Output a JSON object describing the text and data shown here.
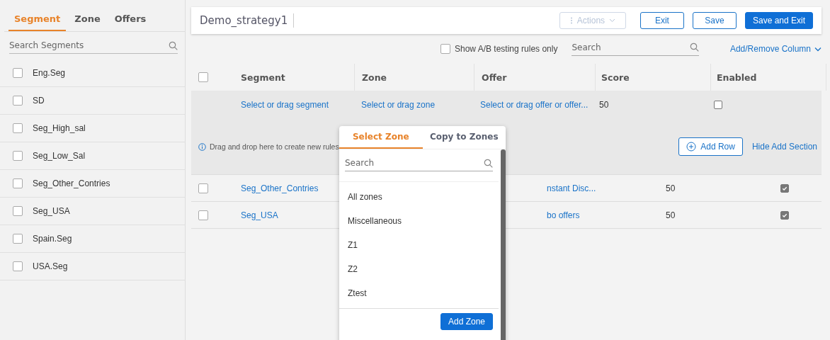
{
  "sidebar": {
    "tabs": [
      {
        "label": "Segment",
        "selected": true
      },
      {
        "label": "Zone",
        "selected": false
      },
      {
        "label": "Offers",
        "selected": false
      }
    ],
    "search": {
      "placeholder": "Search Segments"
    },
    "items": [
      {
        "label": "Eng.Seg",
        "checked": false
      },
      {
        "label": "SD",
        "checked": false
      },
      {
        "label": "Seg_High_sal",
        "checked": false
      },
      {
        "label": "Seg_Low_Sal",
        "checked": false
      },
      {
        "label": "Seg_Other_Contries",
        "checked": false
      },
      {
        "label": "Seg_USA",
        "checked": false
      },
      {
        "label": "Spain.Seg",
        "checked": false
      },
      {
        "label": "USA.Seg",
        "checked": false
      }
    ]
  },
  "header": {
    "title": "Demo_strategy1",
    "actions": {
      "label": "Actions",
      "disabled": true
    },
    "buttons": [
      {
        "label": "Exit",
        "kind": "outline"
      },
      {
        "label": "Save",
        "kind": "outline"
      },
      {
        "label": "Save and Exit",
        "kind": "primary"
      }
    ]
  },
  "toolbar": {
    "ab_filter": {
      "label": "Show A/B testing rules only",
      "checked": false
    },
    "search": {
      "placeholder": "Search"
    },
    "columns_link": "Add/Remove Column"
  },
  "table": {
    "select_all_checked": false,
    "columns": [
      "Segment",
      "Zone",
      "Offer",
      "Score",
      "Enabled"
    ],
    "add_row": {
      "segment": "Select or drag segment",
      "zone": "Select or drag zone",
      "offer": "Select or drag offer or offer...",
      "score": "50",
      "enabled": false
    },
    "add_section": {
      "hint": "Drag and drop here to create new rules",
      "add_button": "Add Row",
      "hide_link": "Hide Add Section"
    },
    "rows": [
      {
        "checked": false,
        "segment": "Seg_Other_Contries",
        "offer": "nstant Disc...",
        "score": "50",
        "enabled": true
      },
      {
        "checked": false,
        "segment": "Seg_USA",
        "offer": "bo offers",
        "score": "50",
        "enabled": true
      }
    ]
  },
  "zone_popup": {
    "tabs": [
      {
        "label": "Select Zone",
        "selected": true
      },
      {
        "label": "Copy to Zones",
        "selected": false
      }
    ],
    "search": {
      "placeholder": "Search"
    },
    "items": [
      "All zones",
      "Miscellaneous",
      "Z1",
      "Z2",
      "Ztest"
    ],
    "button": "Add Zone"
  }
}
